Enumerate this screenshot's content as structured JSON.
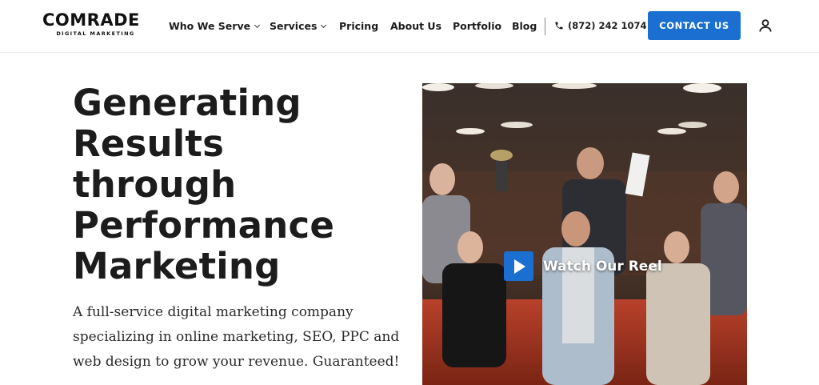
{
  "brand": {
    "name": "COMRADE",
    "tagline": "DIGITAL MARKETING"
  },
  "nav": {
    "items": [
      {
        "label": "Who We Serve",
        "dropdown": true
      },
      {
        "label": "Services",
        "dropdown": true
      },
      {
        "label": "Pricing",
        "dropdown": false
      },
      {
        "label": "About Us",
        "dropdown": false
      },
      {
        "label": "Portfolio",
        "dropdown": false
      },
      {
        "label": "Blog",
        "dropdown": false
      }
    ],
    "phone": "(872) 242 1074",
    "contact_label": "CONTACT US"
  },
  "hero": {
    "title_lines": [
      "Generating",
      "Results",
      "through",
      "Performance",
      "Marketing"
    ],
    "subtitle_lines": [
      "A full-service digital marketing company",
      "specializing in online marketing, SEO, PPC and",
      "web design to grow your revenue. Guaranteed!"
    ],
    "video_label": "Watch Our Reel"
  },
  "colors": {
    "accent": "#1a6fd1",
    "text": "#1c1c1c"
  },
  "icons": [
    "chevron-down-icon",
    "phone-icon",
    "user-icon",
    "play-icon"
  ]
}
